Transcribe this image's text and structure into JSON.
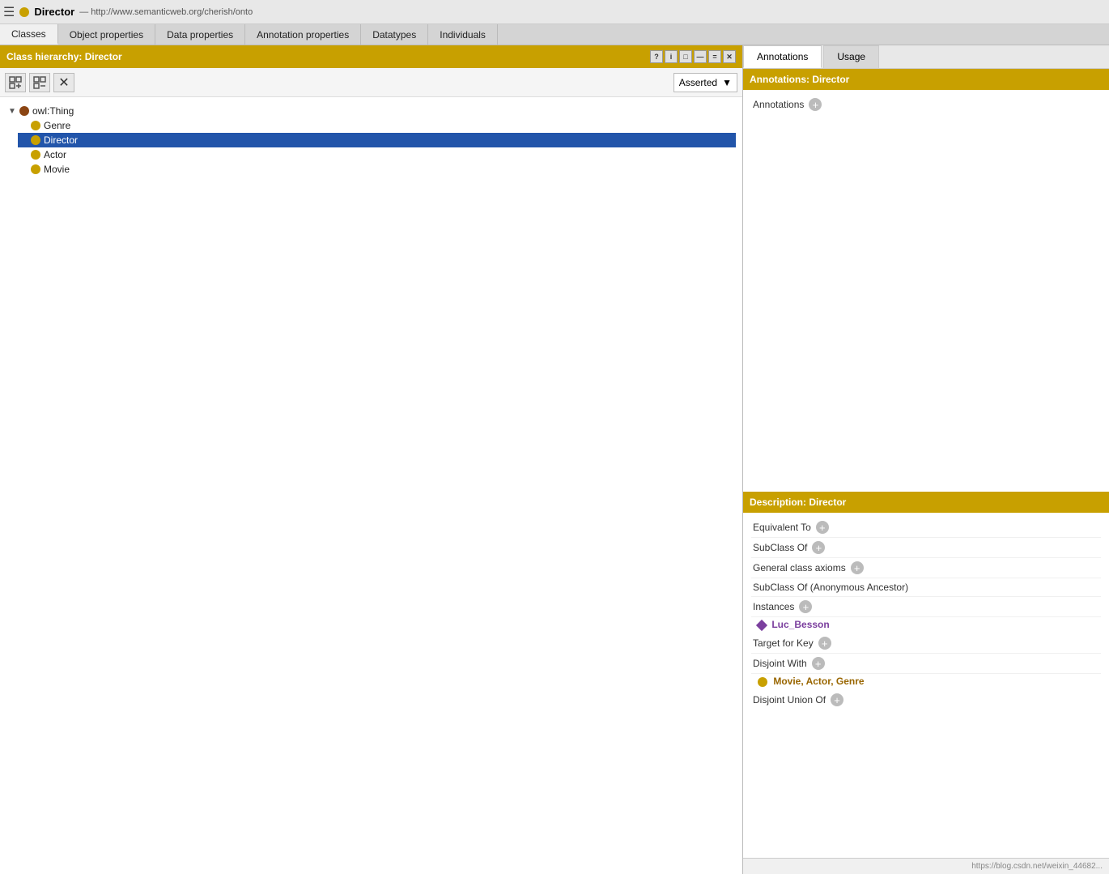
{
  "topbar": {
    "menu_icon": "☰",
    "entity_name": "Director",
    "entity_url": "— http://www.semanticweb.org/cherish/onto",
    "gold_circle": true
  },
  "tabs": [
    {
      "label": "Classes",
      "active": true
    },
    {
      "label": "Object properties",
      "active": false
    },
    {
      "label": "Data properties",
      "active": false
    },
    {
      "label": "Annotation properties",
      "active": false
    },
    {
      "label": "Datatypes",
      "active": false
    },
    {
      "label": "Individuals",
      "active": false
    }
  ],
  "class_hierarchy": {
    "title": "Class hierarchy: Director",
    "controls": [
      "?",
      "i",
      "□",
      "—",
      "=",
      "✕"
    ]
  },
  "toolbar": {
    "btn1": "⇔",
    "btn2": "↔",
    "btn3": "✕",
    "asserted_label": "Asserted",
    "dropdown_arrow": "▼"
  },
  "tree": {
    "items": [
      {
        "id": "owl-thing",
        "label": "owl:Thing",
        "indent": 0,
        "has_expand": true,
        "expanded": true,
        "circle_color": "brown",
        "selected": false
      },
      {
        "id": "genre",
        "label": "Genre",
        "indent": 1,
        "has_expand": false,
        "expanded": false,
        "circle_color": "gold",
        "selected": false
      },
      {
        "id": "director",
        "label": "Director",
        "indent": 1,
        "has_expand": false,
        "expanded": false,
        "circle_color": "gold",
        "selected": true
      },
      {
        "id": "actor",
        "label": "Actor",
        "indent": 1,
        "has_expand": false,
        "expanded": false,
        "circle_color": "gold",
        "selected": false
      },
      {
        "id": "movie",
        "label": "Movie",
        "indent": 1,
        "has_expand": false,
        "expanded": false,
        "circle_color": "gold",
        "selected": false
      }
    ]
  },
  "right_panel": {
    "tabs": [
      {
        "label": "Annotations",
        "active": true
      },
      {
        "label": "Usage",
        "active": false
      }
    ],
    "annotations_section": {
      "title": "Annotations: Director",
      "row_label": "Annotations"
    },
    "description_section": {
      "title": "Description: Director",
      "rows": [
        {
          "label": "Equivalent To"
        },
        {
          "label": "SubClass Of"
        },
        {
          "label": "General class axioms"
        },
        {
          "label": "SubClass Of (Anonymous Ancestor)",
          "no_btn": true
        },
        {
          "label": "Instances",
          "instance": "Luc_Besson"
        },
        {
          "label": "Target for Key"
        },
        {
          "label": "Disjoint With",
          "disjoint": "Movie, Actor, Genre"
        },
        {
          "label": "Disjoint Union Of"
        }
      ]
    }
  },
  "status_bar": {
    "url": "https://blog.csdn.net/weixin_44682..."
  }
}
